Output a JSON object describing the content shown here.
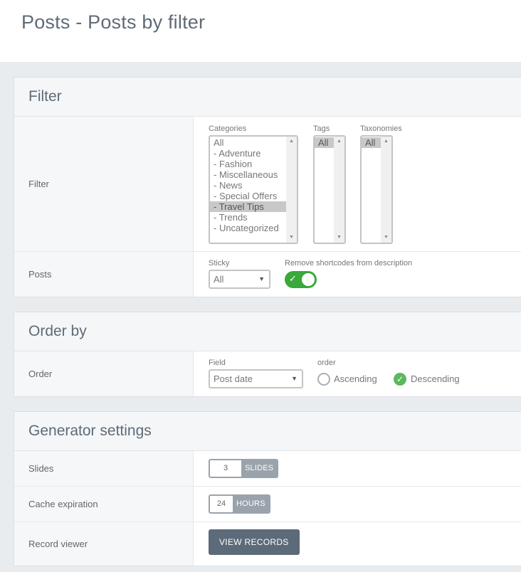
{
  "page": {
    "title": "Posts - Posts by filter"
  },
  "filter_panel": {
    "title": "Filter",
    "filter_row": {
      "label": "Filter",
      "categories": {
        "label": "Categories",
        "options": [
          "All",
          "- Adventure",
          "- Fashion",
          "- Miscellaneous",
          "- News",
          "- Special Offers",
          "- Travel Tips",
          "- Trends",
          "- Uncategorized"
        ],
        "selected": "- Travel Tips"
      },
      "tags": {
        "label": "Tags",
        "options": [
          "All"
        ],
        "selected": "All"
      },
      "taxonomies": {
        "label": "Taxonomies",
        "options": [
          "All"
        ],
        "selected": "All"
      }
    },
    "posts_row": {
      "label": "Posts",
      "sticky": {
        "label": "Sticky",
        "value": "All"
      },
      "remove_shortcodes": {
        "label": "Remove shortcodes from description",
        "on": true
      }
    }
  },
  "order_panel": {
    "title": "Order by",
    "order_row": {
      "label": "Order",
      "field": {
        "label": "Field",
        "value": "Post date"
      },
      "order": {
        "label": "order",
        "ascending": "Ascending",
        "descending": "Descending",
        "selected": "Descending"
      }
    }
  },
  "generator_panel": {
    "title": "Generator settings",
    "slides_row": {
      "label": "Slides",
      "value": "3",
      "unit": "SLIDES"
    },
    "cache_row": {
      "label": "Cache expiration",
      "value": "24",
      "unit": "HOURS"
    },
    "viewer_row": {
      "label": "Record viewer",
      "button": "VIEW RECORDS"
    }
  },
  "colors": {
    "toggle_on": "#3aa83a",
    "radio_checked": "#5cb85c",
    "button": "#5c6b79"
  }
}
